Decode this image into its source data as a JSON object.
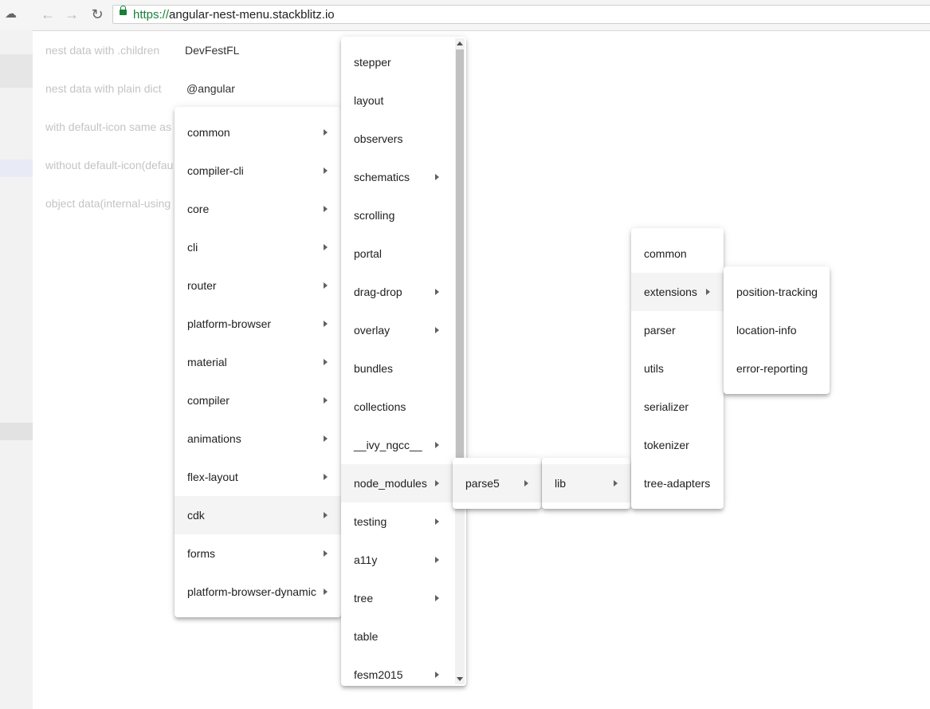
{
  "browser": {
    "url_scheme": "https://",
    "url_host": "angular-nest-menu.stackblitz.io",
    "back_glyph": "←",
    "forward_glyph": "→",
    "reload_glyph": "↻",
    "cloud_glyph": "☁"
  },
  "rows": [
    {
      "label": "nest data with .children",
      "value": "DevFestFL"
    },
    {
      "label": "nest data with plain dict",
      "value": "@angular"
    },
    {
      "label": "with default-icon same as",
      "value": ""
    },
    {
      "label": "without default-icon(defau",
      "value": ""
    },
    {
      "label": "object data(internal-using",
      "value": ""
    }
  ],
  "menu1": {
    "items": [
      {
        "label": "common",
        "submenu": true
      },
      {
        "label": "compiler-cli",
        "submenu": true
      },
      {
        "label": "core",
        "submenu": true
      },
      {
        "label": "cli",
        "submenu": true
      },
      {
        "label": "router",
        "submenu": true
      },
      {
        "label": "platform-browser",
        "submenu": true
      },
      {
        "label": "material",
        "submenu": true
      },
      {
        "label": "compiler",
        "submenu": true
      },
      {
        "label": "animations",
        "submenu": true
      },
      {
        "label": "flex-layout",
        "submenu": true
      },
      {
        "label": "cdk",
        "submenu": true,
        "highlighted": true
      },
      {
        "label": "forms",
        "submenu": true
      },
      {
        "label": "platform-browser-dynamic",
        "submenu": true
      }
    ]
  },
  "menu2": {
    "items": [
      {
        "label": "stepper",
        "submenu": false
      },
      {
        "label": "layout",
        "submenu": false
      },
      {
        "label": "observers",
        "submenu": false
      },
      {
        "label": "schematics",
        "submenu": true
      },
      {
        "label": "scrolling",
        "submenu": false
      },
      {
        "label": "portal",
        "submenu": false
      },
      {
        "label": "drag-drop",
        "submenu": true
      },
      {
        "label": "overlay",
        "submenu": true
      },
      {
        "label": "bundles",
        "submenu": false
      },
      {
        "label": "collections",
        "submenu": false
      },
      {
        "label": "__ivy_ngcc__",
        "submenu": true
      },
      {
        "label": "node_modules",
        "submenu": true,
        "highlighted": true
      },
      {
        "label": "testing",
        "submenu": true
      },
      {
        "label": "a11y",
        "submenu": true
      },
      {
        "label": "tree",
        "submenu": true
      },
      {
        "label": "table",
        "submenu": false
      },
      {
        "label": "fesm2015",
        "submenu": true
      }
    ]
  },
  "menu3": {
    "items": [
      {
        "label": "parse5",
        "submenu": true,
        "highlighted": true
      }
    ]
  },
  "menu4": {
    "items": [
      {
        "label": "lib",
        "submenu": true,
        "highlighted": true
      }
    ]
  },
  "menu5": {
    "items": [
      {
        "label": "common",
        "submenu": false
      },
      {
        "label": "extensions",
        "submenu": true,
        "highlighted": true
      },
      {
        "label": "parser",
        "submenu": false
      },
      {
        "label": "utils",
        "submenu": false
      },
      {
        "label": "serializer",
        "submenu": false
      },
      {
        "label": "tokenizer",
        "submenu": false
      },
      {
        "label": "tree-adapters",
        "submenu": false
      }
    ]
  },
  "menu6": {
    "items": [
      {
        "label": "position-tracking",
        "submenu": false
      },
      {
        "label": "location-info",
        "submenu": false
      },
      {
        "label": "error-reporting",
        "submenu": false
      }
    ]
  }
}
